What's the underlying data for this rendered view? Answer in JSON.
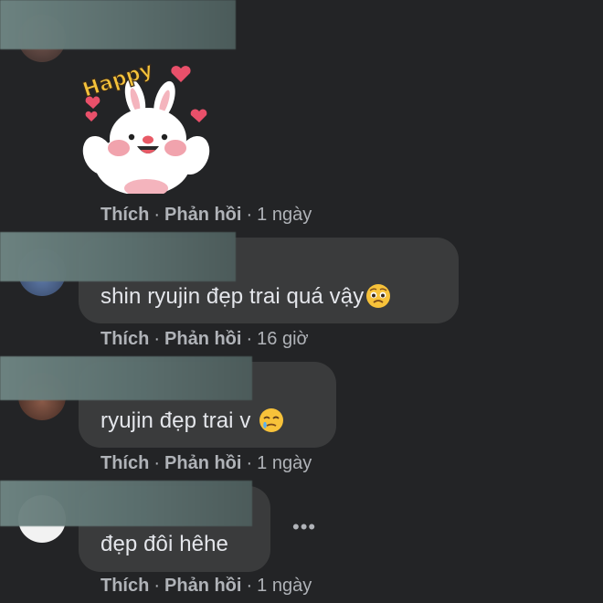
{
  "sticker": {
    "text": "Happy"
  },
  "comments": [
    {
      "text": "",
      "action_like": "Thích",
      "action_reply": "Phản hồi",
      "time": "1 ngày"
    },
    {
      "text": "shin ryujin đẹp trai quá vậy",
      "emoji": "pleading-face",
      "action_like": "Thích",
      "action_reply": "Phản hồi",
      "time": "16 giờ"
    },
    {
      "text": "ryujin đẹp trai v",
      "emoji": "face-holding-back-tears",
      "action_like": "Thích",
      "action_reply": "Phản hồi",
      "time": "1 ngày"
    },
    {
      "text": "đẹp đôi hêhe",
      "action_like": "Thích",
      "action_reply": "Phản hồi",
      "time": "1 ngày"
    }
  ],
  "more_menu": {
    "label": "•••"
  },
  "colors": {
    "background": "#232426",
    "bubble": "#3a3b3c",
    "meta": "#b0b3b8",
    "text": "#e4e6eb"
  }
}
